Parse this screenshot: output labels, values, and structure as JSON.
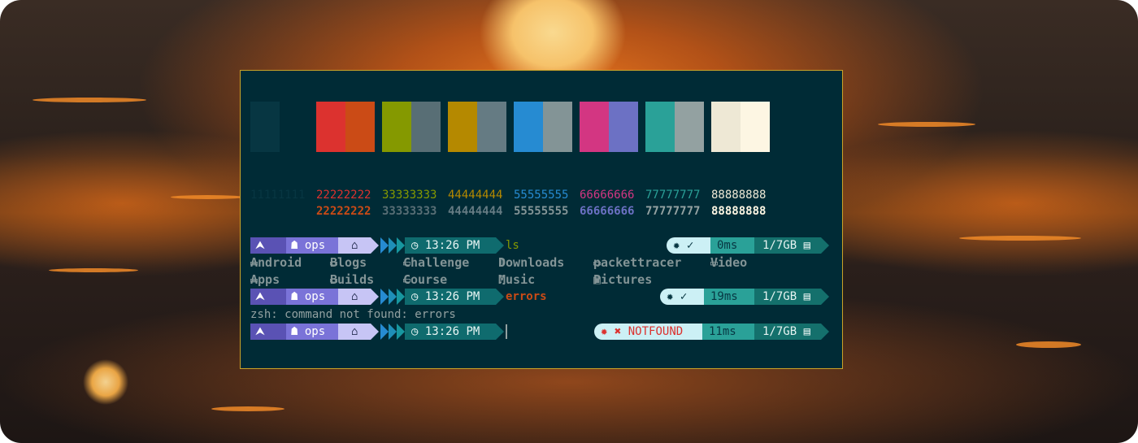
{
  "terminal": {
    "palette": [
      {
        "normal": "#073642",
        "bright": "#002b36"
      },
      {
        "normal": "#dc322f",
        "bright": "#cb4b16"
      },
      {
        "normal": "#859900",
        "bright": "#586e75"
      },
      {
        "normal": "#b58900",
        "bright": "#657b83"
      },
      {
        "normal": "#268bd2",
        "bright": "#839496"
      },
      {
        "normal": "#d33682",
        "bright": "#6c71c4"
      },
      {
        "normal": "#2aa198",
        "bright": "#93a1a1"
      },
      {
        "normal": "#eee8d5",
        "bright": "#fdf6e3"
      }
    ],
    "color_numbers": {
      "normal": [
        "11111111",
        "22222222",
        "33333333",
        "44444444",
        "55555555",
        "66666666",
        "77777777",
        "88888888"
      ],
      "bold": [
        "22222222",
        "33333333",
        "44444444",
        "55555555",
        "66666666",
        "77777777",
        "88888888"
      ]
    },
    "prompt": {
      "arch_icon": "arch-logo-icon",
      "user_icon": "ghost-icon",
      "user": "ops",
      "home_icon": "home-icon",
      "clock_icon": "clock-icon",
      "time": "13:26 PM"
    },
    "lines": [
      {
        "command": "ls",
        "status_icon": "bug-icon",
        "status_mark": "✓",
        "duration": "0ms",
        "memory": "1/7GB"
      },
      {
        "command": "errors",
        "status_icon": "bug-icon",
        "status_mark": "✓",
        "duration": "19ms",
        "memory": "1/7GB"
      },
      {
        "command": "",
        "status_icon": "bug-icon",
        "status_mark": "✖",
        "status_text": "NOTFOUND",
        "duration": "11ms",
        "memory": "1/7GB"
      }
    ],
    "ls_output": {
      "row1": [
        "Android",
        "Blogs",
        "Challenge",
        "Downloads",
        "packettracer",
        "Video"
      ],
      "row2": [
        "Apps",
        "Builds",
        "Course",
        "Music",
        "Pictures"
      ]
    },
    "error_message": "zsh: command not found: errors",
    "colors": {
      "background": "#002b36",
      "border": "#c9a227",
      "cmd_ok": "#859900",
      "cmd_error": "#cb4b16",
      "notfound": "#dc322f"
    }
  }
}
